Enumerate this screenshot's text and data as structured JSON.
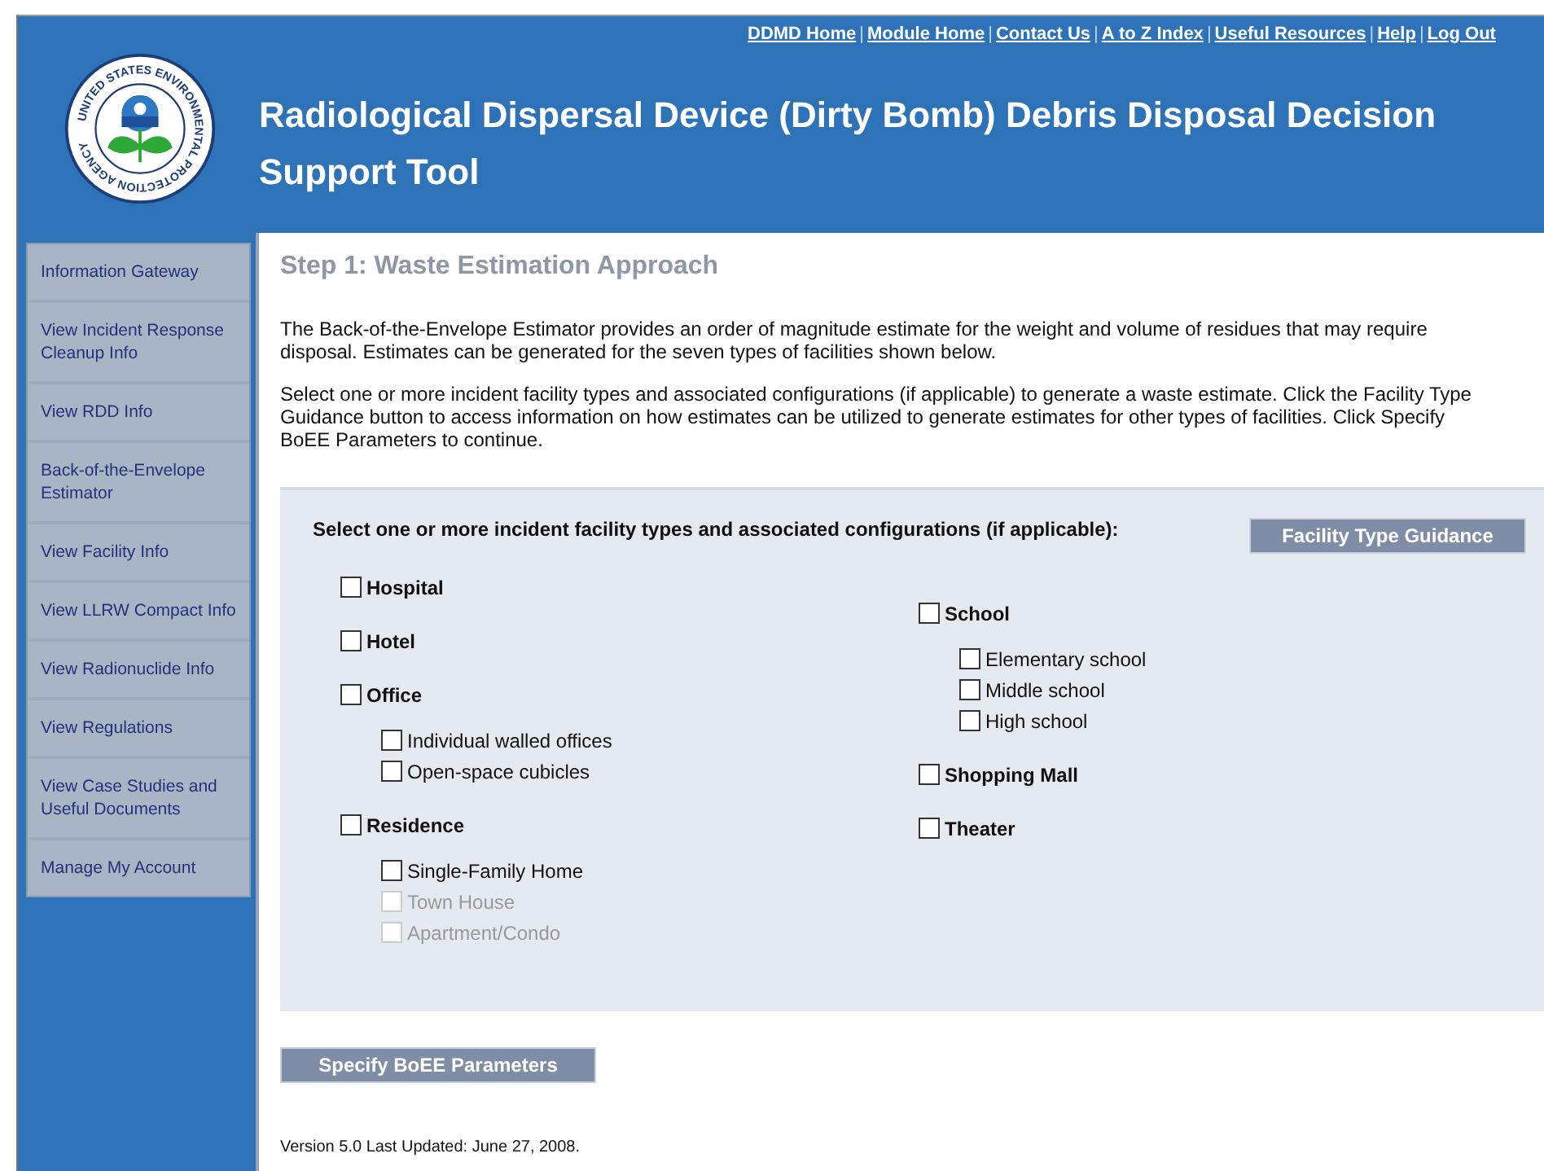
{
  "header": {
    "seal_text": "UNITED STATES ENVIRONMENTAL PROTECTION AGENCY",
    "title": "Radiological Dispersal Device (Dirty Bomb) Debris Disposal Decision Support Tool",
    "links": [
      {
        "label": "DDMD Home"
      },
      {
        "separator": "|",
        "label": "Module Home"
      },
      {
        "separator": "|",
        "label": "Contact Us"
      },
      {
        "separator": "|",
        "label": "A to Z Index"
      },
      {
        "separator": "|",
        "label": "Useful Resources"
      },
      {
        "separator": "|",
        "label": "Help"
      },
      {
        "separator": "|",
        "label": "Log Out"
      }
    ]
  },
  "sidebar": {
    "items": [
      {
        "label": "Information Gateway"
      },
      {
        "label": "View Incident Response Cleanup Info"
      },
      {
        "label": "View RDD Info"
      },
      {
        "label": "Back-of-the-Envelope Estimator"
      },
      {
        "label": "View Facility Info"
      },
      {
        "label": "View LLRW Compact Info"
      },
      {
        "label": "View Radionuclide Info"
      },
      {
        "label": "View Regulations"
      },
      {
        "label": "View Case Studies and Useful Documents"
      },
      {
        "label": "Manage My Account"
      }
    ]
  },
  "main": {
    "heading": "Step 1: Waste Estimation Approach",
    "paragraphs": [
      "The Back-of-the-Envelope Estimator provides an order of magnitude estimate for the weight and volume of residues that may require disposal. Estimates can be generated for the seven types of facilities shown below.",
      "Select one or more incident facility types and associated configurations (if applicable) to generate a waste estimate. Click the Facility Type Guidance button to access information on how estimates can be utilized to generate estimates for other types of facilities. Click Specify BoEE Parameters to continue."
    ],
    "panel": {
      "prompt": "Select one or more incident facility types and associated configurations (if applicable):",
      "guidance_button": {
        "label": "Facility Type Guidance",
        "disabled": true
      },
      "columns": [
        [
          {
            "label": "Hospital",
            "checked": false,
            "disabled": false
          },
          {
            "label": "Hotel",
            "checked": false,
            "disabled": false
          },
          {
            "label": "Office",
            "checked": false,
            "disabled": false,
            "children": [
              {
                "label": "Individual walled offices",
                "checked": false,
                "disabled": false
              },
              {
                "label": "Open-space cubicles",
                "checked": false,
                "disabled": false
              }
            ]
          },
          {
            "label": "Residence",
            "checked": false,
            "disabled": false,
            "children": [
              {
                "label": "Single-Family Home",
                "checked": false,
                "disabled": false
              },
              {
                "label": "Town House",
                "checked": false,
                "disabled": true
              },
              {
                "label": "Apartment/Condo",
                "checked": false,
                "disabled": true
              }
            ]
          }
        ],
        [
          {
            "label": "School",
            "checked": false,
            "disabled": false,
            "children": [
              {
                "label": "Elementary school",
                "checked": false,
                "disabled": false
              },
              {
                "label": "Middle school",
                "checked": false,
                "disabled": false
              },
              {
                "label": "High school",
                "checked": false,
                "disabled": false
              }
            ]
          },
          {
            "label": "Shopping Mall",
            "checked": false,
            "disabled": false
          },
          {
            "label": "Theater",
            "checked": false,
            "disabled": false
          }
        ]
      ]
    },
    "continue_button": {
      "label": "Specify BoEE Parameters",
      "disabled": true
    },
    "footer": "Version 5.0 Last Updated: June 27, 2008."
  }
}
